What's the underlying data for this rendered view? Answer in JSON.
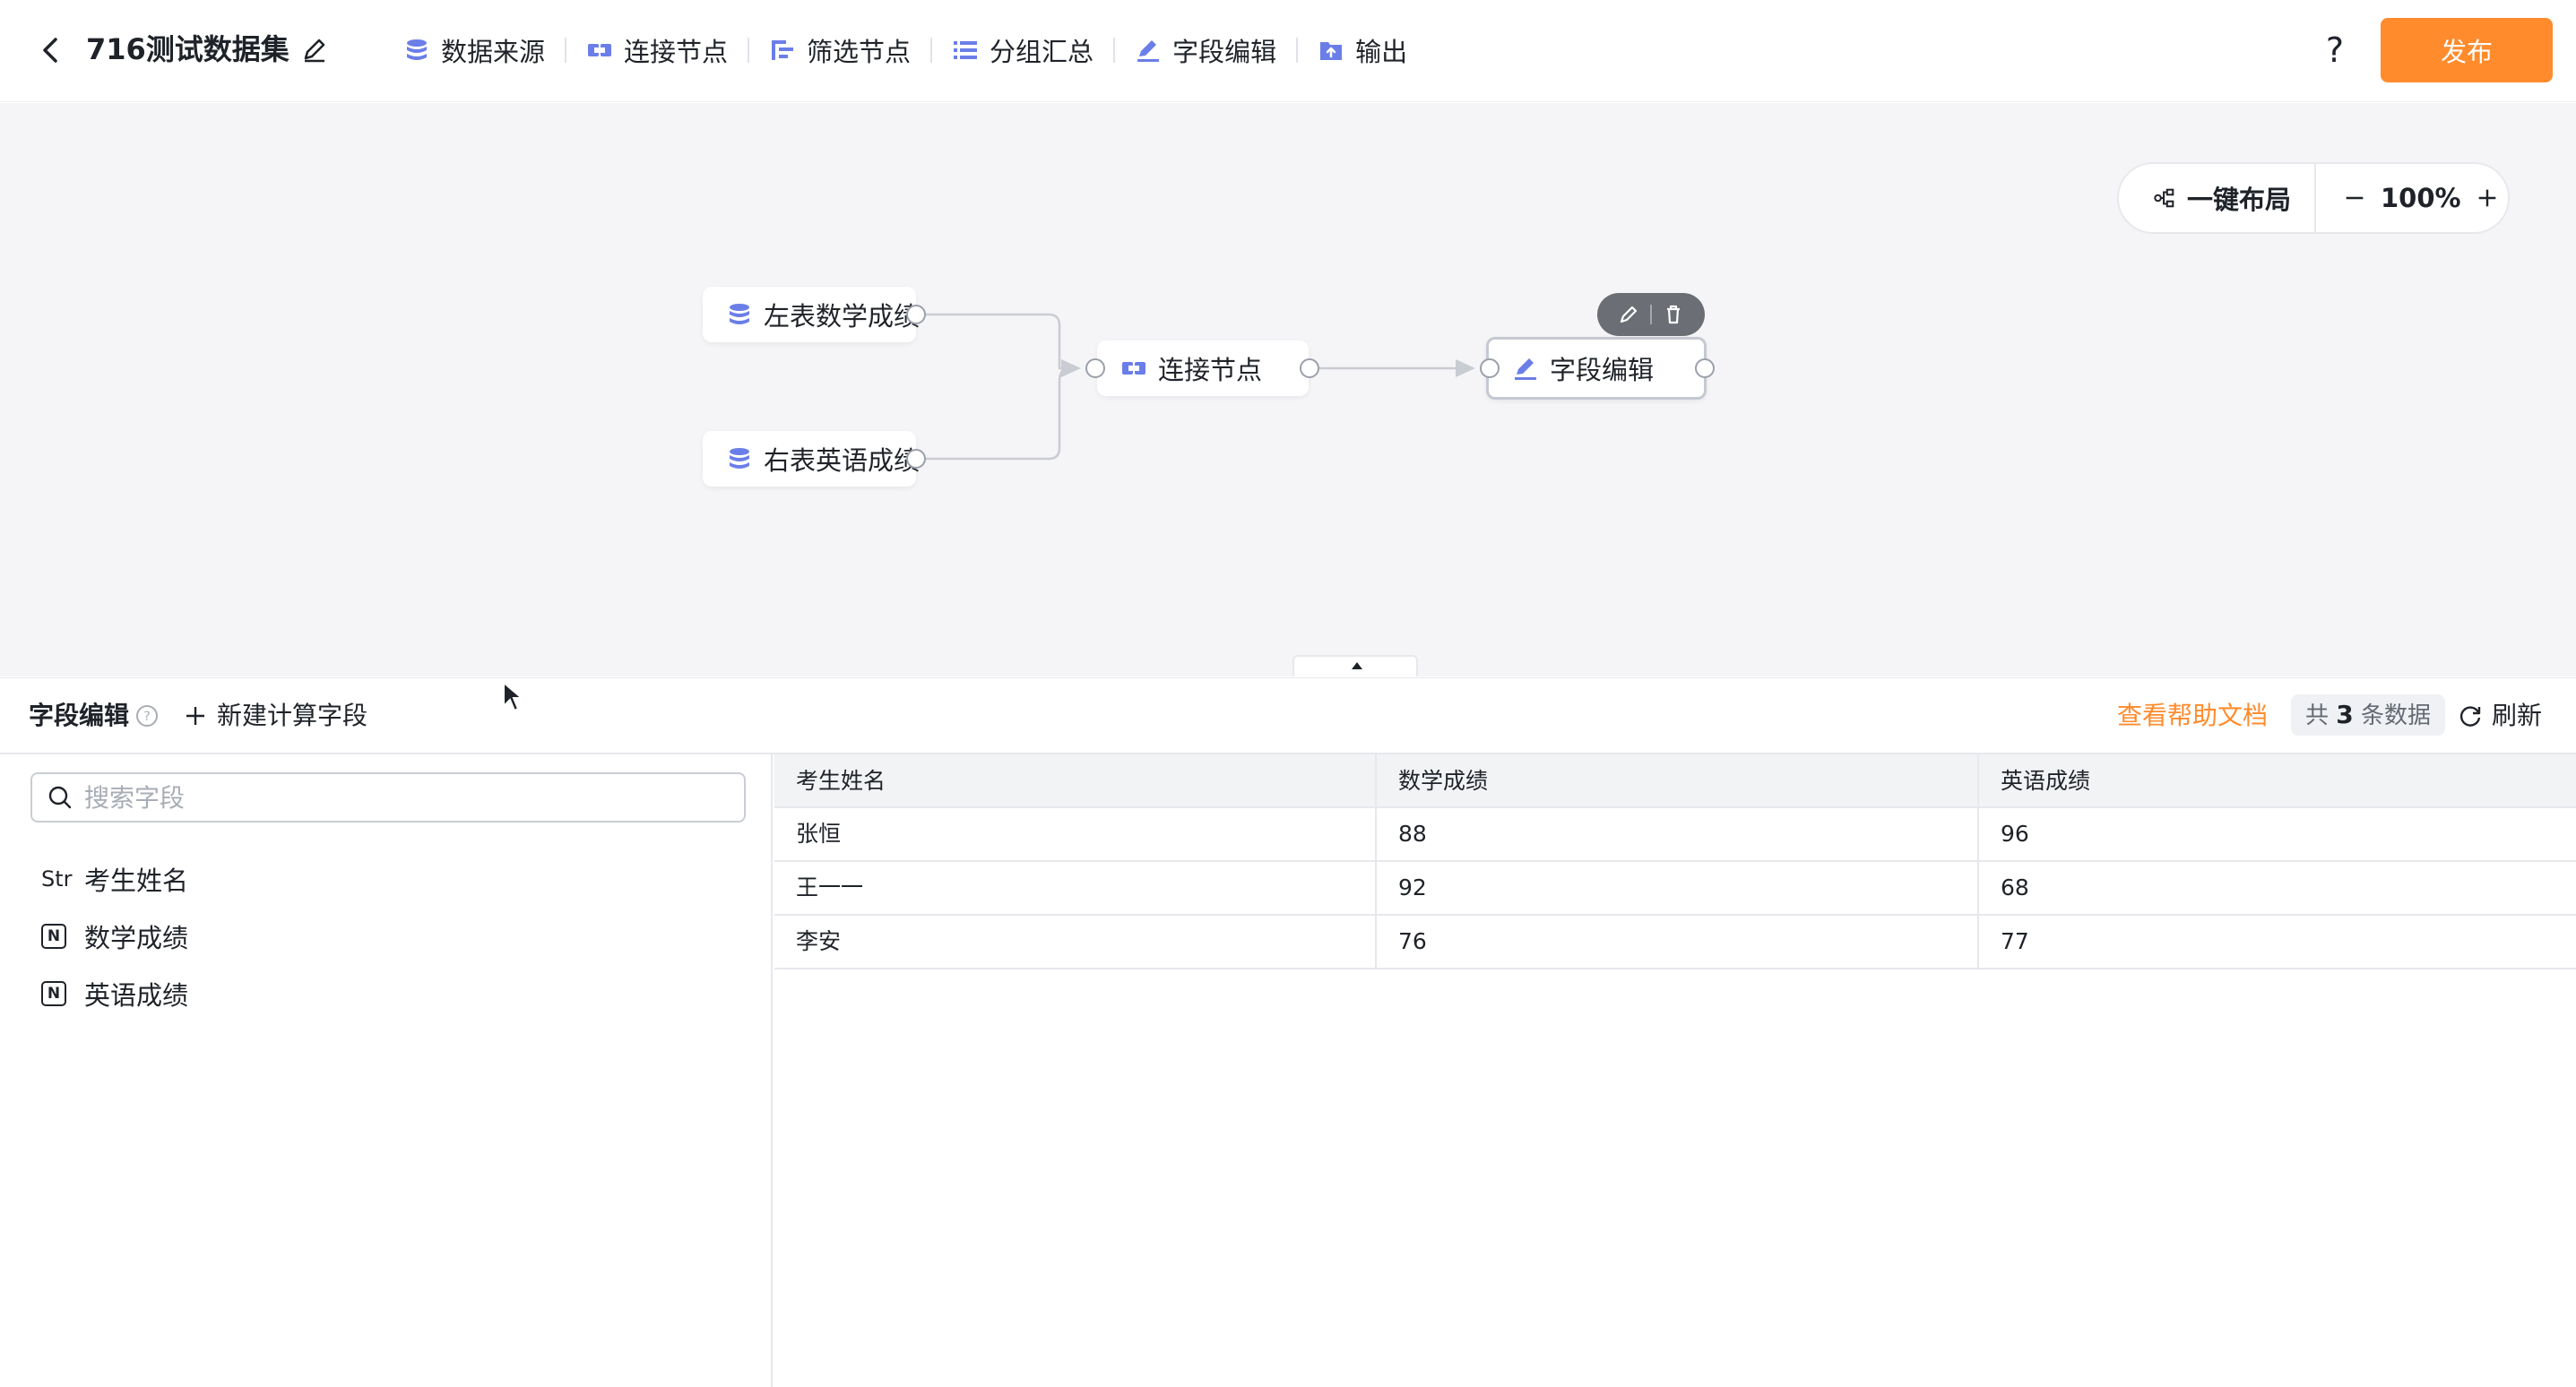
{
  "header": {
    "title": "716测试数据集",
    "toolbar": [
      {
        "label": "数据来源",
        "icon": "database-icon"
      },
      {
        "label": "连接节点",
        "icon": "join-icon"
      },
      {
        "label": "筛选节点",
        "icon": "filter-icon"
      },
      {
        "label": "分组汇总",
        "icon": "group-icon"
      },
      {
        "label": "字段编辑",
        "icon": "pencil-icon"
      },
      {
        "label": "输出",
        "icon": "output-folder-icon"
      }
    ],
    "help": "?",
    "publish_label": "发布"
  },
  "canvas": {
    "auto_layout_label": "一键布局",
    "zoom": "100%",
    "nodes": [
      {
        "label": "左表数学成绩",
        "icon": "database-icon"
      },
      {
        "label": "右表英语成绩",
        "icon": "database-icon"
      },
      {
        "label": "连接节点",
        "icon": "join-icon"
      },
      {
        "label": "字段编辑",
        "icon": "pencil-icon"
      }
    ]
  },
  "panel": {
    "title": "字段编辑",
    "new_field_label": "新建计算字段",
    "help_doc_label": "查看帮助文档",
    "count_prefix": "共",
    "count_value": "3",
    "count_suffix": "条数据",
    "refresh_label": "刷新"
  },
  "fields": {
    "search_placeholder": "搜索字段",
    "items": [
      {
        "type": "Str",
        "name": "考生姓名"
      },
      {
        "type": "N",
        "name": "数学成绩"
      },
      {
        "type": "N",
        "name": "英语成绩"
      }
    ]
  },
  "table": {
    "columns": [
      "考生姓名",
      "数学成绩",
      "英语成绩"
    ],
    "rows": [
      [
        "张恒",
        "88",
        "96"
      ],
      [
        "王一一",
        "92",
        "68"
      ],
      [
        "李安",
        "76",
        "77"
      ]
    ]
  },
  "colors": {
    "accent": "#ff8b2c",
    "icon": "#6b7ee8",
    "canvas_bg": "#f5f5f7"
  }
}
